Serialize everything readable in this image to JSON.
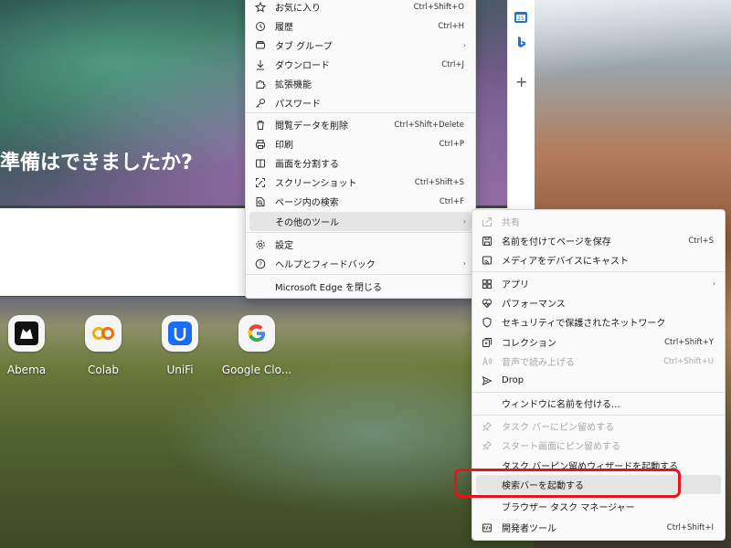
{
  "greeting": "準備はできましたか?",
  "quick_links": [
    {
      "label": "Abema",
      "icon": "abema-icon"
    },
    {
      "label": "Colab",
      "icon": "colab-icon"
    },
    {
      "label": "UniFi",
      "icon": "unifi-icon"
    },
    {
      "label": "Google Clo...",
      "icon": "google-icon"
    }
  ],
  "sidebar": {
    "outlook_icon": "outlook-icon",
    "bing_icon": "bing-icon",
    "add": "+"
  },
  "main_menu": {
    "items": [
      {
        "label": "お気に入り",
        "shortcut": "Ctrl+Shift+O",
        "icon": "favorites-icon"
      },
      {
        "label": "履歴",
        "shortcut": "Ctrl+H",
        "icon": "history-icon"
      },
      {
        "label": "タブ グループ",
        "arrow": "›",
        "icon": "tab-groups-icon"
      },
      {
        "label": "ダウンロード",
        "shortcut": "Ctrl+J",
        "icon": "download-icon"
      },
      {
        "label": "拡張機能",
        "icon": "extensions-icon"
      },
      {
        "label": "パスワード",
        "icon": "key-icon"
      },
      {
        "label": "閲覧データを削除",
        "shortcut": "Ctrl+Shift+Delete",
        "icon": "trash-icon"
      },
      {
        "label": "印刷",
        "shortcut": "Ctrl+P",
        "icon": "print-icon"
      },
      {
        "label": "画面を分割する",
        "icon": "split-screen-icon"
      },
      {
        "label": "スクリーンショット",
        "shortcut": "Ctrl+Shift+S",
        "icon": "screenshot-icon"
      },
      {
        "label": "ページ内の検索",
        "shortcut": "Ctrl+F",
        "icon": "find-icon"
      },
      {
        "label": "その他のツール",
        "arrow": "›"
      },
      {
        "label": "設定",
        "icon": "gear-icon"
      },
      {
        "label": "ヘルプとフィードバック",
        "arrow": "›",
        "icon": "help-icon"
      },
      {
        "label": "Microsoft Edge を閉じる"
      }
    ]
  },
  "sub_menu": {
    "items": [
      {
        "label": "共有",
        "disabled": true,
        "icon": "share-icon"
      },
      {
        "label": "名前を付けてページを保存",
        "shortcut": "Ctrl+S",
        "icon": "save-icon"
      },
      {
        "label": "メディアをデバイスにキャスト",
        "icon": "cast-icon"
      },
      {
        "label": "アプリ",
        "arrow": "›",
        "icon": "apps-icon"
      },
      {
        "label": "パフォーマンス",
        "icon": "performance-icon"
      },
      {
        "label": "セキュリティで保護されたネットワーク",
        "icon": "shield-icon"
      },
      {
        "label": "コレクション",
        "shortcut": "Ctrl+Shift+Y",
        "icon": "collections-icon"
      },
      {
        "label": "音声で読み上げる",
        "shortcut": "Ctrl+Shift+U",
        "disabled": true,
        "icon": "read-aloud-icon"
      },
      {
        "label": "Drop",
        "icon": "drop-icon"
      },
      {
        "label": "ウィンドウに名前を付ける..."
      },
      {
        "label": "タスク バーにピン留めする",
        "disabled": true,
        "icon": "pin-icon"
      },
      {
        "label": "スタート画面にピン留めする",
        "disabled": true,
        "icon": "pin-icon"
      },
      {
        "label": "タスク バーピン留めウィザードを起動する"
      },
      {
        "label": "検索バーを起動する"
      },
      {
        "label": "ブラウザー タスク マネージャー"
      },
      {
        "label": "開発者ツール",
        "shortcut": "Ctrl+Shift+I",
        "icon": "devtools-icon"
      }
    ]
  },
  "colors": {
    "highlight": "#e8141c",
    "hover": "#e5e5e5",
    "disabled_text": "#a8a8a8"
  }
}
